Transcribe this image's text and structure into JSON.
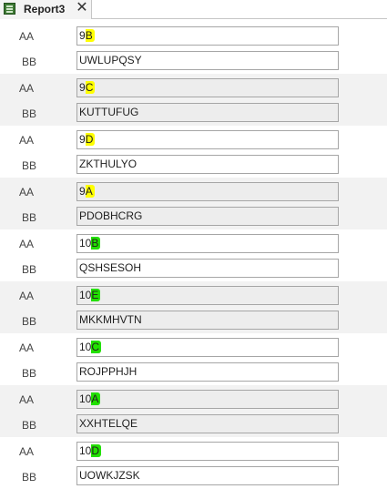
{
  "tab": {
    "title": "Report3",
    "icon": "report-icon",
    "close_label": "✕"
  },
  "labels": {
    "field1": "AA",
    "field2": "BB"
  },
  "colors": {
    "highlight_yellow": "#ffff00",
    "highlight_green": "#22e000"
  },
  "records": [
    {
      "aa_prefix": "9",
      "aa_highlight": "B",
      "aa_color": "yellow",
      "bb": "UWLUPQSY"
    },
    {
      "aa_prefix": "9",
      "aa_highlight": "C",
      "aa_color": "yellow",
      "bb": "KUTTUFUG"
    },
    {
      "aa_prefix": "9",
      "aa_highlight": "D",
      "aa_color": "yellow",
      "bb": "ZKTHULYO"
    },
    {
      "aa_prefix": "9",
      "aa_highlight": "A",
      "aa_color": "yellow",
      "bb": "PDOBHCRG"
    },
    {
      "aa_prefix": "10",
      "aa_highlight": "B",
      "aa_color": "green",
      "bb": "QSHSESOH"
    },
    {
      "aa_prefix": "10",
      "aa_highlight": "E",
      "aa_color": "green",
      "bb": "MKKMHVTN"
    },
    {
      "aa_prefix": "10",
      "aa_highlight": "C",
      "aa_color": "green",
      "bb": "ROJPPHJH"
    },
    {
      "aa_prefix": "10",
      "aa_highlight": "A",
      "aa_color": "green",
      "bb": "XXHTELQE"
    },
    {
      "aa_prefix": "10",
      "aa_highlight": "D",
      "aa_color": "green",
      "bb": "UOWKJZSK"
    }
  ]
}
